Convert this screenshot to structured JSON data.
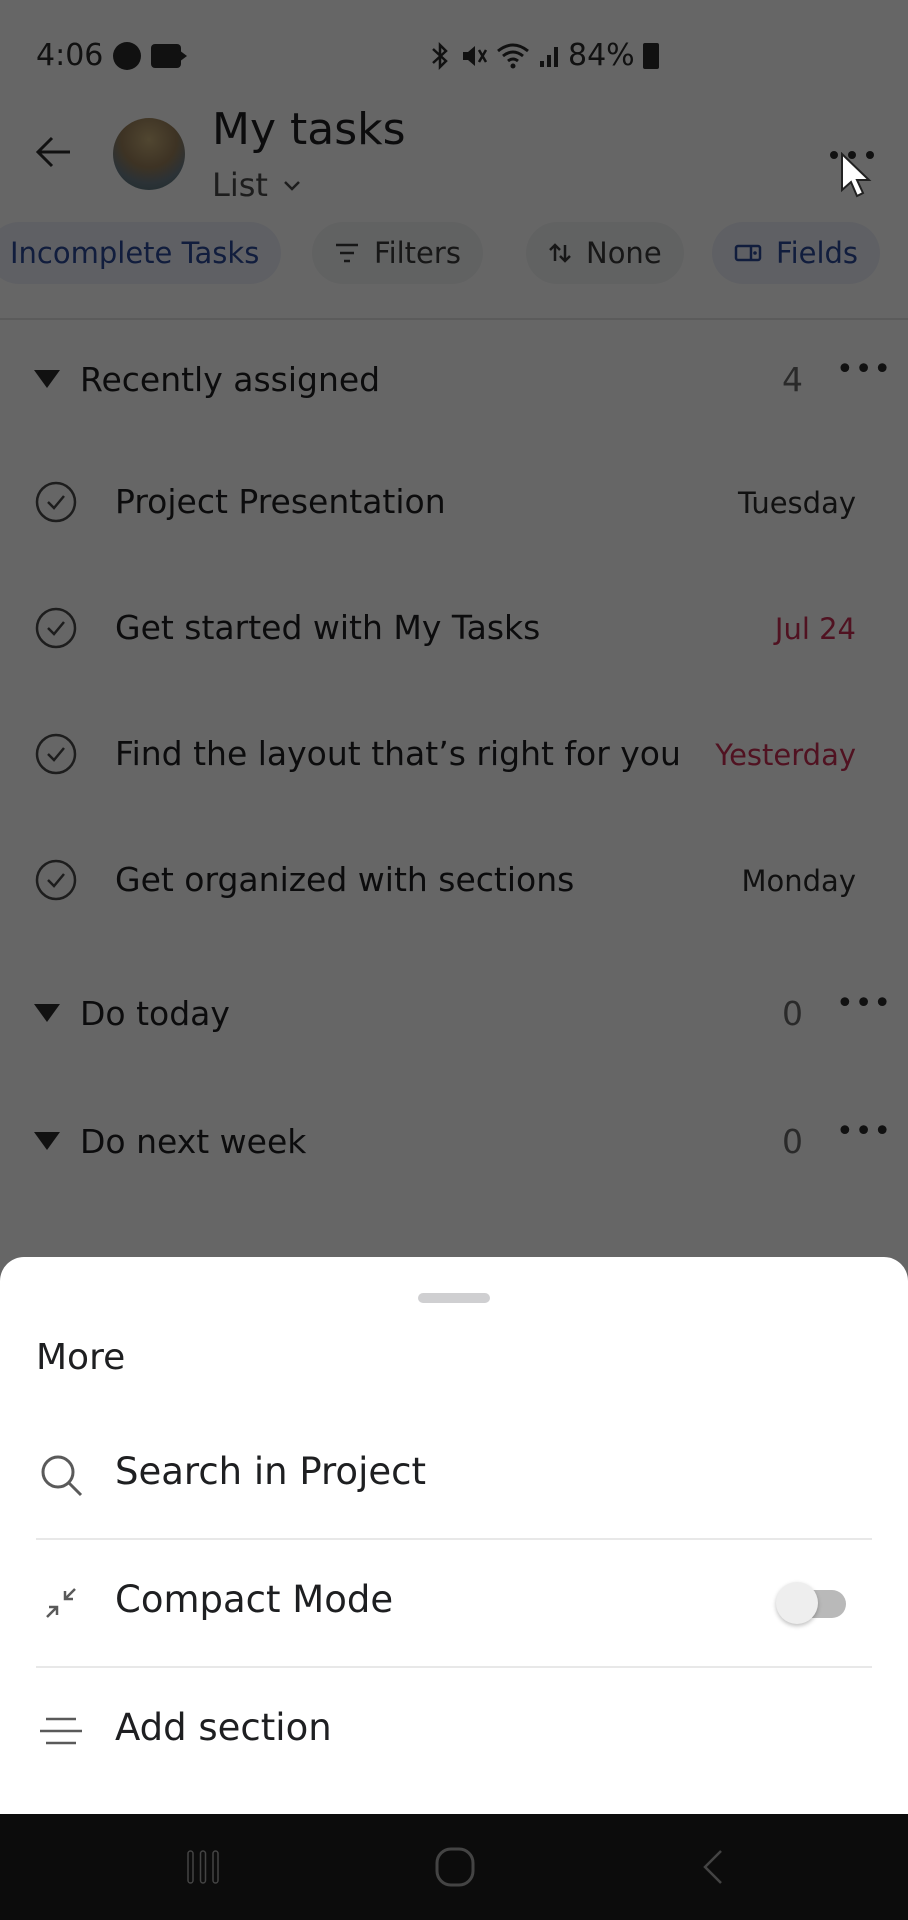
{
  "status_bar": {
    "time": "4:06",
    "left_icons": [
      "messenger-icon",
      "video-icon"
    ],
    "right_icons": [
      "bluetooth-icon",
      "mute-icon",
      "wifi-icon",
      "signal-icon"
    ],
    "battery": "84%"
  },
  "header": {
    "title": "My tasks",
    "view": "List",
    "back_icon": "arrow-left-icon",
    "more_icon": "more-horizontal-icon"
  },
  "chips": [
    {
      "label": "Incomplete Tasks",
      "icon": null,
      "active": true
    },
    {
      "label": "Filters",
      "icon": "filter-icon",
      "active": false
    },
    {
      "label": "None",
      "icon": "sort-icon",
      "active": false
    },
    {
      "label": "Fields",
      "icon": "fields-icon",
      "active": true
    }
  ],
  "sections": [
    {
      "name": "Recently assigned",
      "count": "4",
      "tasks": [
        {
          "name": "Project Presentation",
          "due": "Tuesday",
          "overdue": false
        },
        {
          "name": "Get started with My Tasks",
          "due": "Jul 24",
          "overdue": true
        },
        {
          "name": "Find the layout that’s right for you",
          "due": "Yesterday",
          "overdue": true
        },
        {
          "name": "Get organized with sections",
          "due": "Monday",
          "overdue": false
        }
      ]
    },
    {
      "name": "Do today",
      "count": "0",
      "tasks": []
    },
    {
      "name": "Do next week",
      "count": "0",
      "tasks": []
    }
  ],
  "sheet": {
    "title": "More",
    "items": [
      {
        "label": "Search in Project",
        "icon": "search-icon"
      },
      {
        "label": "Compact Mode",
        "icon": "compress-icon",
        "toggle": false
      },
      {
        "label": "Add section",
        "icon": "add-section-icon"
      }
    ]
  },
  "colors": {
    "accent_blue": "#2c4a9a",
    "overdue_red": "#c92f54",
    "scrim": "rgba(0,0,0,0.60)"
  }
}
